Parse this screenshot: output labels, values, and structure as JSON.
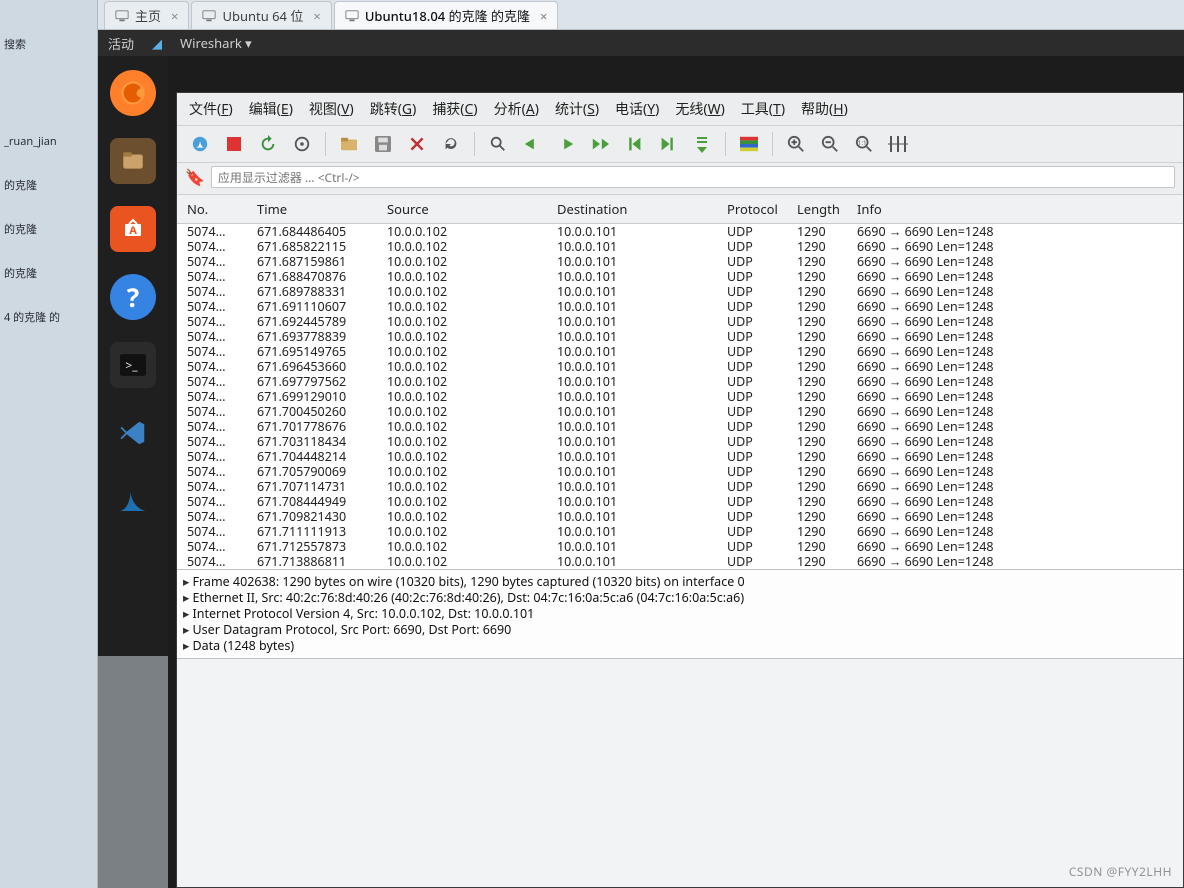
{
  "desktop": {
    "search_label": "搜索",
    "tree_items": [
      "_ruan_jian",
      "的克隆",
      "的克隆",
      "的克隆",
      "",
      "4 的克隆 的"
    ]
  },
  "vm_tabs": [
    {
      "label": "主页",
      "active": false
    },
    {
      "label": "Ubuntu 64 位",
      "active": false
    },
    {
      "label": "Ubuntu18.04 的克隆 的克隆",
      "active": true
    }
  ],
  "gnome": {
    "activities": "活动",
    "app": "Wireshark ▾"
  },
  "menus": [
    "文件(F)",
    "编辑(E)",
    "视图(V)",
    "跳转(G)",
    "捕获(C)",
    "分析(A)",
    "统计(S)",
    "电话(Y)",
    "无线(W)",
    "工具(T)",
    "帮助(H)"
  ],
  "filter_placeholder": "应用显示过滤器 … <Ctrl-/>",
  "columns": [
    "No.",
    "Time",
    "Source",
    "Destination",
    "Protocol",
    "Length",
    "Info"
  ],
  "packets": [
    {
      "no": "5074…",
      "time": "671.684486405",
      "src": "10.0.0.102",
      "dst": "10.0.0.101",
      "proto": "UDP",
      "len": "1290",
      "info": "6690 → 6690 Len=1248"
    },
    {
      "no": "5074…",
      "time": "671.685822115",
      "src": "10.0.0.102",
      "dst": "10.0.0.101",
      "proto": "UDP",
      "len": "1290",
      "info": "6690 → 6690 Len=1248"
    },
    {
      "no": "5074…",
      "time": "671.687159861",
      "src": "10.0.0.102",
      "dst": "10.0.0.101",
      "proto": "UDP",
      "len": "1290",
      "info": "6690 → 6690 Len=1248"
    },
    {
      "no": "5074…",
      "time": "671.688470876",
      "src": "10.0.0.102",
      "dst": "10.0.0.101",
      "proto": "UDP",
      "len": "1290",
      "info": "6690 → 6690 Len=1248"
    },
    {
      "no": "5074…",
      "time": "671.689788331",
      "src": "10.0.0.102",
      "dst": "10.0.0.101",
      "proto": "UDP",
      "len": "1290",
      "info": "6690 → 6690 Len=1248"
    },
    {
      "no": "5074…",
      "time": "671.691110607",
      "src": "10.0.0.102",
      "dst": "10.0.0.101",
      "proto": "UDP",
      "len": "1290",
      "info": "6690 → 6690 Len=1248"
    },
    {
      "no": "5074…",
      "time": "671.692445789",
      "src": "10.0.0.102",
      "dst": "10.0.0.101",
      "proto": "UDP",
      "len": "1290",
      "info": "6690 → 6690 Len=1248"
    },
    {
      "no": "5074…",
      "time": "671.693778839",
      "src": "10.0.0.102",
      "dst": "10.0.0.101",
      "proto": "UDP",
      "len": "1290",
      "info": "6690 → 6690 Len=1248"
    },
    {
      "no": "5074…",
      "time": "671.695149765",
      "src": "10.0.0.102",
      "dst": "10.0.0.101",
      "proto": "UDP",
      "len": "1290",
      "info": "6690 → 6690 Len=1248",
      "mark": true
    },
    {
      "no": "5074…",
      "time": "671.696453660",
      "src": "10.0.0.102",
      "dst": "10.0.0.101",
      "proto": "UDP",
      "len": "1290",
      "info": "6690 → 6690 Len=1248",
      "mark": true
    },
    {
      "no": "5074…",
      "time": "671.697797562",
      "src": "10.0.0.102",
      "dst": "10.0.0.101",
      "proto": "UDP",
      "len": "1290",
      "info": "6690 → 6690 Len=1248",
      "mark": true
    },
    {
      "no": "5074…",
      "time": "671.699129010",
      "src": "10.0.0.102",
      "dst": "10.0.0.101",
      "proto": "UDP",
      "len": "1290",
      "info": "6690 → 6690 Len=1248"
    },
    {
      "no": "5074…",
      "time": "671.700450260",
      "src": "10.0.0.102",
      "dst": "10.0.0.101",
      "proto": "UDP",
      "len": "1290",
      "info": "6690 → 6690 Len=1248"
    },
    {
      "no": "5074…",
      "time": "671.701778676",
      "src": "10.0.0.102",
      "dst": "10.0.0.101",
      "proto": "UDP",
      "len": "1290",
      "info": "6690 → 6690 Len=1248"
    },
    {
      "no": "5074…",
      "time": "671.703118434",
      "src": "10.0.0.102",
      "dst": "10.0.0.101",
      "proto": "UDP",
      "len": "1290",
      "info": "6690 → 6690 Len=1248",
      "mark": true
    },
    {
      "no": "5074…",
      "time": "671.704448214",
      "src": "10.0.0.102",
      "dst": "10.0.0.101",
      "proto": "UDP",
      "len": "1290",
      "info": "6690 → 6690 Len=1248"
    },
    {
      "no": "5074…",
      "time": "671.705790069",
      "src": "10.0.0.102",
      "dst": "10.0.0.101",
      "proto": "UDP",
      "len": "1290",
      "info": "6690 → 6690 Len=1248",
      "mark": true
    },
    {
      "no": "5074…",
      "time": "671.707114731",
      "src": "10.0.0.102",
      "dst": "10.0.0.101",
      "proto": "UDP",
      "len": "1290",
      "info": "6690 → 6690 Len=1248"
    },
    {
      "no": "5074…",
      "time": "671.708444949",
      "src": "10.0.0.102",
      "dst": "10.0.0.101",
      "proto": "UDP",
      "len": "1290",
      "info": "6690 → 6690 Len=1248"
    },
    {
      "no": "5074…",
      "time": "671.709821430",
      "src": "10.0.0.102",
      "dst": "10.0.0.101",
      "proto": "UDP",
      "len": "1290",
      "info": "6690 → 6690 Len=1248"
    },
    {
      "no": "5074…",
      "time": "671.711111913",
      "src": "10.0.0.102",
      "dst": "10.0.0.101",
      "proto": "UDP",
      "len": "1290",
      "info": "6690 → 6690 Len=1248"
    },
    {
      "no": "5074…",
      "time": "671.712557873",
      "src": "10.0.0.102",
      "dst": "10.0.0.101",
      "proto": "UDP",
      "len": "1290",
      "info": "6690 → 6690 Len=1248"
    },
    {
      "no": "5074…",
      "time": "671.713886811",
      "src": "10.0.0.102",
      "dst": "10.0.0.101",
      "proto": "UDP",
      "len": "1290",
      "info": "6690 → 6690 Len=1248"
    }
  ],
  "details": [
    "Frame 402638: 1290 bytes on wire (10320 bits), 1290 bytes captured (10320 bits) on interface 0",
    "Ethernet II, Src: 40:2c:76:8d:40:26 (40:2c:76:8d:40:26), Dst: 04:7c:16:0a:5c:a6 (04:7c:16:0a:5c:a6)",
    "Internet Protocol Version 4, Src: 10.0.0.102, Dst: 10.0.0.101",
    "User Datagram Protocol, Src Port: 6690, Dst Port: 6690",
    "Data (1248 bytes)"
  ],
  "watermark": "CSDN @FYY2LHH"
}
